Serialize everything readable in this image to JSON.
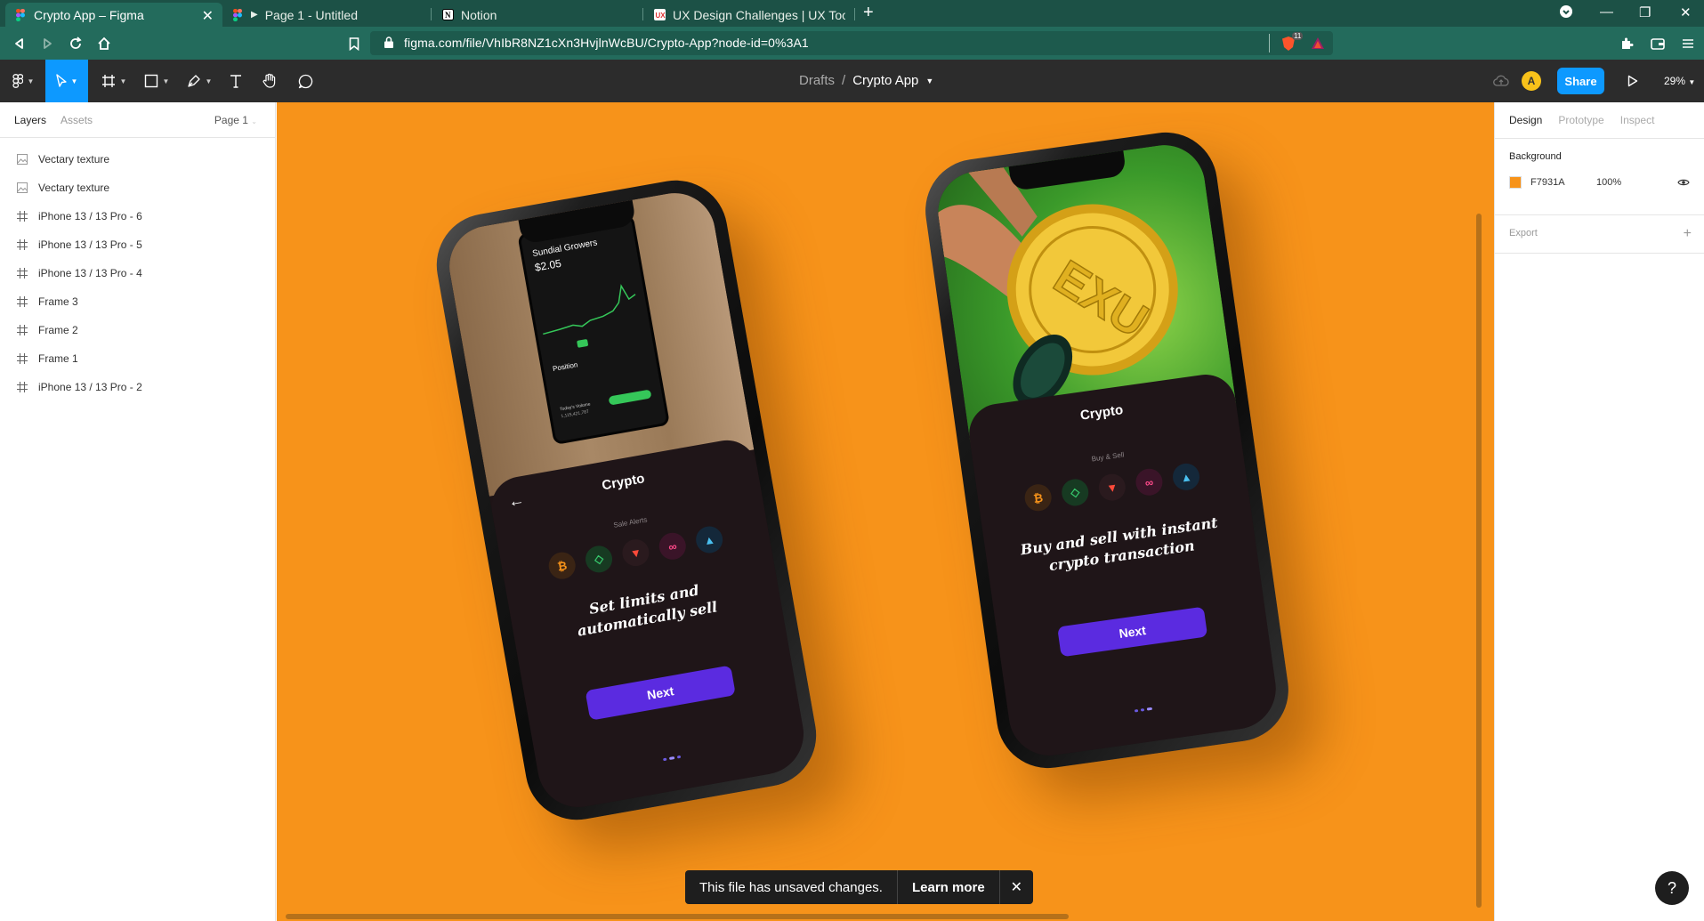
{
  "browser": {
    "tabs": [
      {
        "title": "Crypto App – Figma",
        "active": true
      },
      {
        "title": "Page 1 - Untitled",
        "active": false
      },
      {
        "title": "Notion",
        "active": false
      },
      {
        "title": "UX Design Challenges | UX Tools",
        "active": false
      }
    ],
    "url": "figma.com/file/VhIbR8NZ1cXn3HvjlnWcBU/Crypto-App?node-id=0%3A1",
    "brave_count": "11"
  },
  "figma": {
    "breadcrumb_parent": "Drafts",
    "breadcrumb_sep": "/",
    "file_name": "Crypto App",
    "avatar_initial": "A",
    "share_label": "Share",
    "zoom": "29%"
  },
  "left_panel": {
    "tab_layers": "Layers",
    "tab_assets": "Assets",
    "page_selector": "Page 1",
    "layers": [
      {
        "name": "Vectary texture",
        "type": "image"
      },
      {
        "name": "Vectary texture",
        "type": "image"
      },
      {
        "name": "iPhone 13 / 13 Pro - 6",
        "type": "frame"
      },
      {
        "name": "iPhone 13 / 13 Pro - 5",
        "type": "frame"
      },
      {
        "name": "iPhone 13 / 13 Pro - 4",
        "type": "frame"
      },
      {
        "name": "Frame 3",
        "type": "frame"
      },
      {
        "name": "Frame 2",
        "type": "frame"
      },
      {
        "name": "Frame 1",
        "type": "frame"
      },
      {
        "name": "iPhone 13 / 13 Pro - 2",
        "type": "frame"
      }
    ]
  },
  "canvas": {
    "background": "#F7931A",
    "phone_left": {
      "app_title": "Crypto",
      "subtitle": "Sale Alerts",
      "headline_1": "Set limits and",
      "headline_2": "automatically sell",
      "button": "Next",
      "photo_stock_name": "Sundial Growers",
      "photo_stock_price": "$2.05",
      "photo_position_label": "Position",
      "photo_volume_label": "Today's Volume",
      "photo_volume_value": "1,115,421,787"
    },
    "phone_right": {
      "app_title": "Crypto",
      "subtitle": "Buy & Sell",
      "headline_1": "Buy and sell with instant",
      "headline_2": "crypto transaction",
      "button": "Next",
      "coin_text": "EXU"
    },
    "coins": [
      {
        "icon": "bitcoin-icon",
        "glyph": "₿",
        "color": "#F7931A",
        "bg": "#3a2414"
      },
      {
        "icon": "code-coin-icon",
        "glyph": "◇",
        "color": "#36c46a",
        "bg": "#173a22"
      },
      {
        "icon": "tron-icon",
        "glyph": "▼",
        "color": "#ff4a3a",
        "bg": "#2a1a1e"
      },
      {
        "icon": "link-coin-icon",
        "glyph": "∞",
        "color": "#ff4a8a",
        "bg": "#3a1428"
      },
      {
        "icon": "triangle-coin-icon",
        "glyph": "▲",
        "color": "#4ac0f0",
        "bg": "#14283a"
      }
    ],
    "toast": {
      "message": "This file has unsaved changes.",
      "action": "Learn more"
    }
  },
  "right_panel": {
    "tab_design": "Design",
    "tab_prototype": "Prototype",
    "tab_inspect": "Inspect",
    "background_label": "Background",
    "background_hex": "F7931A",
    "background_opacity": "100%",
    "export_label": "Export"
  },
  "help_label": "?"
}
